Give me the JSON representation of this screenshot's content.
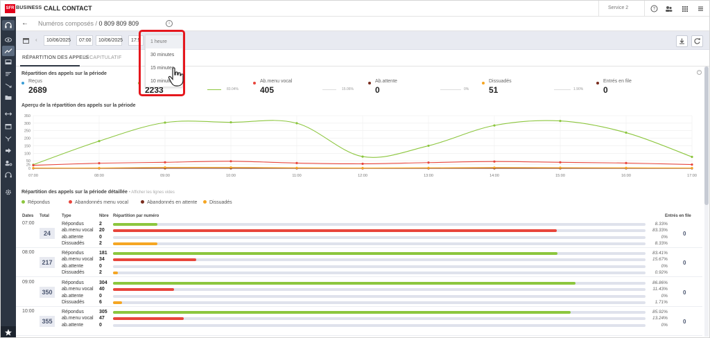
{
  "brand": {
    "logo_text": "SFR",
    "business": "BUSINESS",
    "app_title": "CALL CONTACT"
  },
  "top": {
    "service": "Service 2",
    "icons": [
      "help-icon",
      "users-icon",
      "apps-grid-icon",
      "menu-icon"
    ]
  },
  "sidebar": {
    "items": [
      "headset-icon",
      "eye-icon",
      "trend-icon",
      "inbox-icon",
      "sort-icon",
      "shuffle-icon",
      "folder-icon",
      "arrows-icon",
      "window-icon",
      "branch-icon",
      "forward-icon",
      "person-settings-icon",
      "headphones-icon",
      "gear-icon"
    ],
    "active_index": 2,
    "bottom": "star-icon"
  },
  "breadcrumb": {
    "back": "←",
    "title": "Numéros composés /",
    "number": "0 809 809 809",
    "info": "i"
  },
  "filters": {
    "date_from": "10/06/2025",
    "time_from": "07:00",
    "date_to": "10/06/2025",
    "time_to": "17:5",
    "interval_options": [
      "1 heure",
      "30 minutes",
      "15 minutes",
      "10 minutes"
    ],
    "selected_interval": "1 heure"
  },
  "tabs": [
    {
      "label": "RÉPARTITION DES APPELS"
    },
    {
      "label": "RÉCAPITULATIF"
    }
  ],
  "summary": {
    "title": "Répartition des appels sur la période",
    "kpis": [
      {
        "label": "Reçus",
        "value": "2689",
        "color": "#3b9ed6",
        "pct": ""
      },
      {
        "label": "",
        "value": "2233",
        "color": "#8cc63e",
        "pct": "83.04%"
      },
      {
        "label": "Ab.menu vocal",
        "value": "405",
        "color": "#e8453c",
        "pct": "15.06%"
      },
      {
        "label": "Ab.attente",
        "value": "0",
        "color": "#7a2d1e",
        "pct": "0%"
      },
      {
        "label": "Dissuadés",
        "value": "51",
        "color": "#f5a623",
        "pct": "1.90%"
      },
      {
        "label": "Entrés en file",
        "value": "0",
        "color": "#7a2d1e",
        "pct": ""
      }
    ]
  },
  "chart_title": "Aperçu de la répartition des appels sur la période",
  "chart_data": {
    "type": "line",
    "x": [
      "07:00",
      "08:00",
      "09:00",
      "10:00",
      "11:00",
      "12:00",
      "13:00",
      "14:00",
      "15:00",
      "16:00",
      "17:00"
    ],
    "ylim": [
      0,
      350
    ],
    "yticks": [
      0,
      25,
      50,
      100,
      150,
      200,
      250,
      300,
      350
    ],
    "series": [
      {
        "color": "#8cc63e",
        "values": [
          24,
          181,
          304,
          306,
          300,
          78,
          150,
          285,
          315,
          237,
          76
        ]
      },
      {
        "color": "#e8453c",
        "values": [
          20,
          34,
          40,
          47,
          35,
          30,
          38,
          45,
          40,
          35,
          25
        ]
      },
      {
        "color": "#7a2d1e",
        "values": [
          0,
          0,
          0,
          0,
          0,
          0,
          0,
          0,
          0,
          0,
          0
        ]
      },
      {
        "color": "#f5a623",
        "values": [
          2,
          2,
          6,
          6,
          3,
          2,
          3,
          5,
          4,
          3,
          2
        ]
      }
    ],
    "grid": true
  },
  "detail": {
    "title": "Répartition des appels sur la période détaillée",
    "subtitle": "• Afficher les lignes vides",
    "legend": [
      {
        "label": "Répondus",
        "color": "#8cc63e"
      },
      {
        "label": "Abandonnés menu vocal",
        "color": "#e8453c"
      },
      {
        "label": "Abandonnés en attente",
        "color": "#7a2d1e"
      },
      {
        "label": "Dissuadés",
        "color": "#f5a623"
      }
    ],
    "headers": {
      "dates": "Dates",
      "total": "Total",
      "type": "Type",
      "nbr": "Nbre",
      "rep": "Répartition par numéro",
      "entres": "Entrés en file"
    },
    "groups": [
      {
        "time": "07:00",
        "total": "24",
        "entres": "0",
        "rows": [
          {
            "type": "Répondus",
            "nbr": "2",
            "pct": "8.33%",
            "frac": 0.0833,
            "color": "#8cc63e"
          },
          {
            "type": "ab.menu vocal",
            "nbr": "20",
            "pct": "83.33%",
            "frac": 0.8333,
            "color": "#e8453c"
          },
          {
            "type": "ab.attente",
            "nbr": "0",
            "pct": "0%",
            "frac": 0,
            "color": "#7a2d1e"
          },
          {
            "type": "Dissuadés",
            "nbr": "2",
            "pct": "8.33%",
            "frac": 0.0833,
            "color": "#f5a623"
          }
        ]
      },
      {
        "time": "08:00",
        "total": "217",
        "entres": "0",
        "rows": [
          {
            "type": "Répondus",
            "nbr": "181",
            "pct": "83.41%",
            "frac": 0.8341,
            "color": "#8cc63e"
          },
          {
            "type": "ab.menu vocal",
            "nbr": "34",
            "pct": "15.67%",
            "frac": 0.1567,
            "color": "#e8453c"
          },
          {
            "type": "ab.attente",
            "nbr": "0",
            "pct": "0%",
            "frac": 0,
            "color": "#7a2d1e"
          },
          {
            "type": "Dissuadés",
            "nbr": "2",
            "pct": "0.92%",
            "frac": 0.0092,
            "color": "#f5a623"
          }
        ]
      },
      {
        "time": "09:00",
        "total": "350",
        "entres": "0",
        "rows": [
          {
            "type": "Répondus",
            "nbr": "304",
            "pct": "86.86%",
            "frac": 0.8686,
            "color": "#8cc63e"
          },
          {
            "type": "ab.menu vocal",
            "nbr": "40",
            "pct": "11.43%",
            "frac": 0.1143,
            "color": "#e8453c"
          },
          {
            "type": "ab.attente",
            "nbr": "0",
            "pct": "0%",
            "frac": 0,
            "color": "#7a2d1e"
          },
          {
            "type": "Dissuadés",
            "nbr": "6",
            "pct": "1.71%",
            "frac": 0.0171,
            "color": "#f5a623"
          }
        ]
      },
      {
        "time": "10:00",
        "total": "355",
        "entres": "0",
        "rows": [
          {
            "type": "Répondus",
            "nbr": "305",
            "pct": "85.92%",
            "frac": 0.8592,
            "color": "#8cc63e"
          },
          {
            "type": "ab.menu vocal",
            "nbr": "47",
            "pct": "13.24%",
            "frac": 0.1324,
            "color": "#e8453c"
          },
          {
            "type": "ab.attente",
            "nbr": "0",
            "pct": "0%",
            "frac": 0,
            "color": "#7a2d1e"
          }
        ]
      }
    ]
  }
}
